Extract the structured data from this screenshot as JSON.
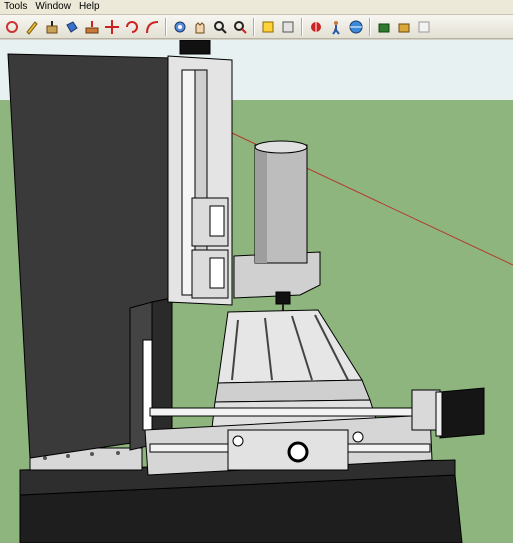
{
  "menubar": {
    "items": [
      {
        "label": "Tools"
      },
      {
        "label": "Window"
      },
      {
        "label": "Help"
      }
    ]
  },
  "toolbar": {
    "groups": [
      [
        "rotate-icon",
        "pencil-icon",
        "push-pull-icon",
        "paint-bucket-icon",
        "follow-me-icon",
        "move-icon",
        "rotate-arrows-icon",
        "offset-icon"
      ],
      [
        "orbit-icon",
        "pan-icon",
        "zoom-icon",
        "zoom-extents-icon"
      ],
      [
        "section-plane-icon",
        "component-icon"
      ],
      [
        "add-location-icon",
        "walk-icon",
        "globe-icon"
      ],
      [
        "3d-warehouse-icon",
        "share-model-icon",
        "extension-icon"
      ]
    ]
  },
  "colors": {
    "sky": "#e8f1f2",
    "ground": "#8eb57e",
    "machine_dark": "#3c3c3c",
    "machine_light": "#d9d9d9",
    "axis_red": "#b33a2a"
  }
}
